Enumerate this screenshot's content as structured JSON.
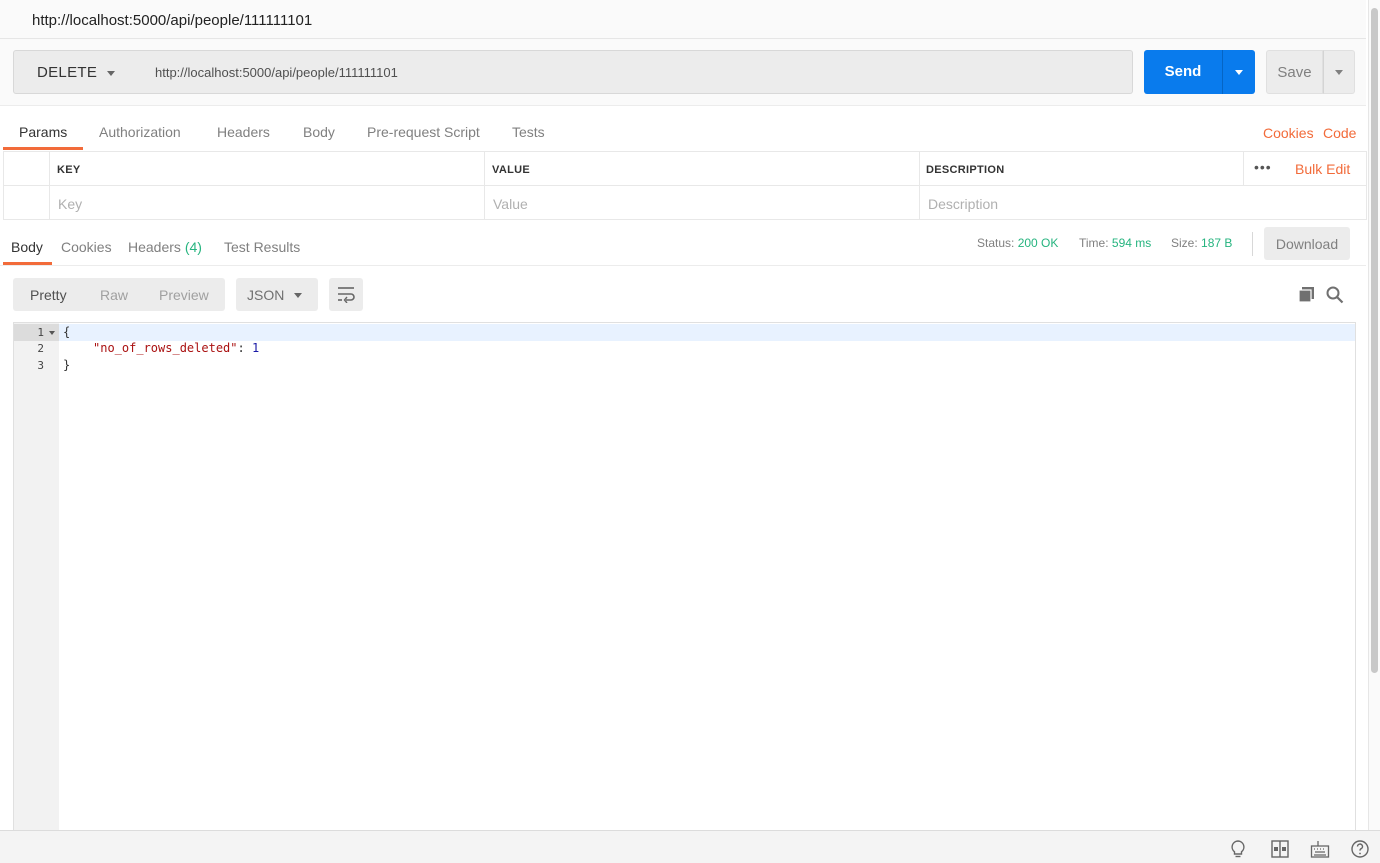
{
  "title": "http://localhost:5000/api/people/111111101",
  "request": {
    "method": "DELETE",
    "url": "http://localhost:5000/api/people/111111101",
    "send_label": "Send",
    "save_label": "Save"
  },
  "request_tabs": [
    "Params",
    "Authorization",
    "Headers",
    "Body",
    "Pre-request Script",
    "Tests"
  ],
  "links": {
    "cookies": "Cookies",
    "code": "Code"
  },
  "params": {
    "headers": {
      "key": "KEY",
      "value": "VALUE",
      "description": "DESCRIPTION"
    },
    "bulk_edit": "Bulk Edit",
    "more": "•••",
    "placeholders": {
      "key": "Key",
      "value": "Value",
      "description": "Description"
    }
  },
  "response_tabs": {
    "body": "Body",
    "cookies": "Cookies",
    "headers": "Headers",
    "headers_count": "(4)",
    "test_results": "Test Results"
  },
  "response_meta": {
    "status_label": "Status:",
    "status_value": "200 OK",
    "time_label": "Time:",
    "time_value": "594 ms",
    "size_label": "Size:",
    "size_value": "187 B",
    "download": "Download"
  },
  "format_tabs": [
    "Pretty",
    "Raw",
    "Preview"
  ],
  "content_type": "JSON",
  "editor": {
    "line_numbers": [
      "1",
      "2",
      "3"
    ],
    "open_brace": "{",
    "key": "\"no_of_rows_deleted\"",
    "colon": ":",
    "value": "1",
    "close_brace": "}"
  },
  "colors": {
    "accent_orange": "#f26b3a",
    "send_blue": "#097bed",
    "status_green": "#26b47f"
  }
}
